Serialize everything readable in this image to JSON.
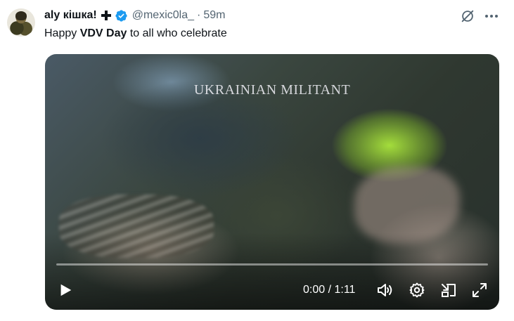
{
  "tweet": {
    "display_name": "aly кішка!",
    "handle": "@mexic0la_",
    "separator": "·",
    "time": "59m",
    "text_parts": [
      "Happy ",
      "VDV Day",
      " to all who celebrate"
    ]
  },
  "video": {
    "caption": "UKRAINIAN MILITANT",
    "current_time": "0:00",
    "duration": "1:11",
    "time_display": "0:00 / 1:11",
    "progress_fraction": 0.0
  },
  "icons": {
    "plus": "plus-icon",
    "verified": "verified-badge-icon",
    "grok": "grok-icon",
    "more": "more-icon",
    "play": "play-icon",
    "volume": "volume-icon",
    "settings": "settings-icon",
    "pip": "pip-icon",
    "fullscreen": "fullscreen-icon"
  },
  "colors": {
    "verified": "#1d9bf0",
    "secondary_text": "#536471",
    "primary_text": "#0f1419"
  }
}
